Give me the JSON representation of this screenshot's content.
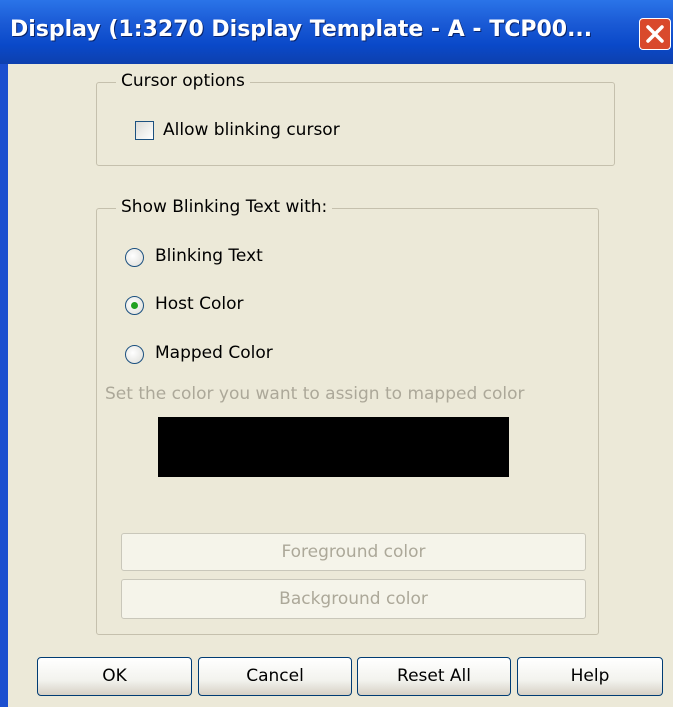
{
  "window": {
    "title": "Display (1:3270 Display Template - A - TCP00...",
    "close_icon": "close-icon",
    "close_color": "#d9492c"
  },
  "cursor_options": {
    "legend": "Cursor options",
    "allow_blinking_cursor": {
      "label": "Allow blinking cursor",
      "checked": false
    }
  },
  "blinking_text": {
    "legend": "Show Blinking Text with:",
    "options": [
      {
        "label": "Blinking Text",
        "selected": false
      },
      {
        "label": "Host Color",
        "selected": true
      },
      {
        "label": "Mapped Color",
        "selected": false
      }
    ],
    "hint": "Set the color you want to assign to mapped color",
    "mapped_color": "#000000",
    "foreground_button": "Foreground color",
    "background_button": "Background color"
  },
  "buttons": {
    "ok": "OK",
    "cancel": "Cancel",
    "reset_all": "Reset All",
    "help": "Help"
  }
}
